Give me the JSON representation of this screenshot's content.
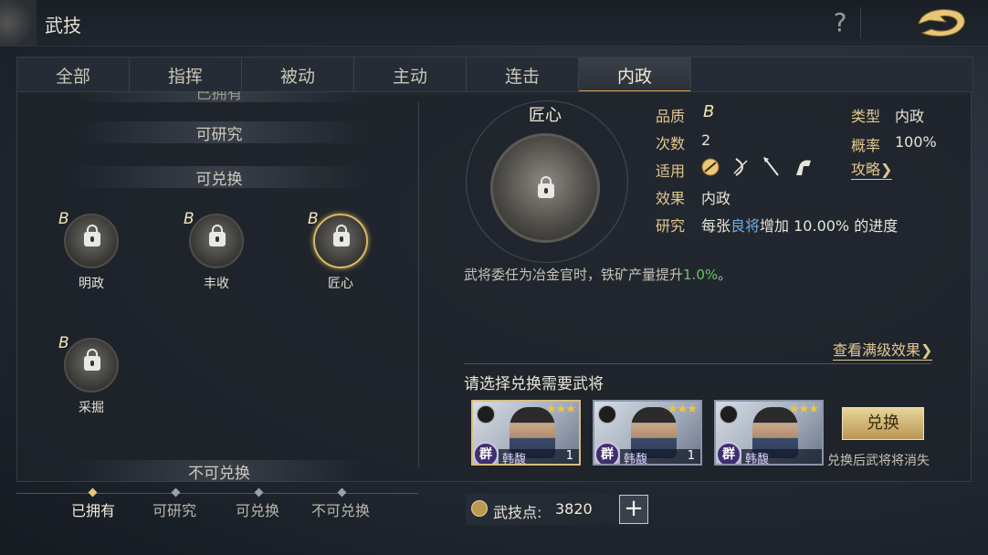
{
  "header": {
    "title": "武技",
    "help_icon": "question-mark",
    "back_icon": "dragon-back"
  },
  "tabs": [
    {
      "label": "全部",
      "active": false
    },
    {
      "label": "指挥",
      "active": false
    },
    {
      "label": "被动",
      "active": false
    },
    {
      "label": "主动",
      "active": false
    },
    {
      "label": "连击",
      "active": false
    },
    {
      "label": "内政",
      "active": true
    }
  ],
  "left_list": {
    "partial_header": "已拥有",
    "researchable_header": "可研究",
    "exchangeable_header": "可兑换",
    "not_exchangeable_header": "不可兑换",
    "skills": [
      {
        "name": "明政",
        "grade": "B",
        "locked": true,
        "selected": false
      },
      {
        "name": "丰收",
        "grade": "B",
        "locked": true,
        "selected": false
      },
      {
        "name": "匠心",
        "grade": "B",
        "locked": true,
        "selected": true
      },
      {
        "name": "采掘",
        "grade": "B",
        "locked": true,
        "selected": false
      }
    ]
  },
  "bottom_tabs": [
    {
      "label": "已拥有",
      "active": true
    },
    {
      "label": "可研究",
      "active": false
    },
    {
      "label": "可兑换",
      "active": false
    },
    {
      "label": "不可兑换",
      "active": false
    }
  ],
  "detail": {
    "name": "匠心",
    "quality_label": "品质",
    "quality_value": "B",
    "count_label": "次数",
    "count_value": "2",
    "apply_label": "适用",
    "apply_icons": [
      "shield-icon",
      "bow-icon",
      "spear-icon",
      "horse-icon"
    ],
    "effect_label": "效果",
    "effect_value": "内政",
    "research_label": "研究",
    "research_prefix": "每张",
    "research_highlight": "良将",
    "research_suffix": "增加 10.00% 的进度",
    "type_label": "类型",
    "type_value": "内政",
    "rate_label": "概率",
    "rate_value": "100%",
    "strategy_link": "攻略❯",
    "effect_text_prefix": "武将委任为冶金官时，铁矿产量提升",
    "effect_text_pct": "1.0%",
    "effect_text_suffix": "。",
    "max_effect_link": "查看满级效果❯"
  },
  "exchange": {
    "title": "请选择兑换需要武将",
    "cards": [
      {
        "faction": "群",
        "name": "韩馥",
        "count": "1",
        "stars": "★★★",
        "selected": true
      },
      {
        "faction": "群",
        "name": "韩馥",
        "count": "1",
        "stars": "★★★",
        "selected": false
      },
      {
        "faction": "群",
        "name": "韩馥",
        "count": "",
        "stars": "★★★",
        "selected": false
      }
    ],
    "button_label": "兑换",
    "note": "兑换后武将将消失"
  },
  "points": {
    "label": "武技点:",
    "value": "3820",
    "add_label": "+"
  },
  "colors": {
    "accent_gold": "#e0c88f",
    "highlight_blue": "#6fa8e0",
    "percent_green": "#6ec06e"
  }
}
